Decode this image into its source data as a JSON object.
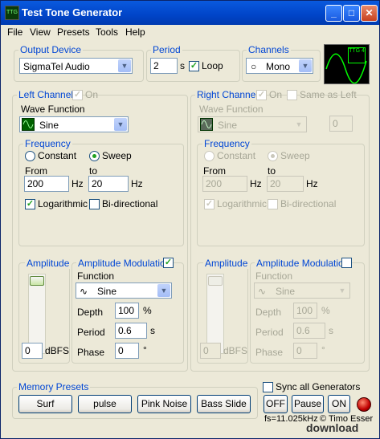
{
  "window": {
    "title": "Test Tone Generator",
    "icon_text": "TTG"
  },
  "menu": [
    {
      "label": "File"
    },
    {
      "label": "View"
    },
    {
      "label": "Presets"
    },
    {
      "label": "Tools"
    },
    {
      "label": "Help"
    }
  ],
  "output_device": {
    "label": "Output Device",
    "value": "SigmaTel Audio"
  },
  "period": {
    "label": "Period",
    "value": "2",
    "unit": "s",
    "loop_label": "Loop",
    "loop_checked": true
  },
  "channels": {
    "label": "Channels",
    "value": "Mono"
  },
  "scope": {
    "tag": "TTG 4"
  },
  "left": {
    "title": "Left Channel",
    "on_label": "On",
    "wave_function_label": "Wave Function",
    "wave": "Sine",
    "frequency_label": "Frequency",
    "constant_label": "Constant",
    "sweep_label": "Sweep",
    "from_label": "From",
    "to_label": "to",
    "from_value": "200",
    "to_value": "20",
    "hz": "Hz",
    "log_label": "Logarithmic",
    "bidir_label": "Bi-directional",
    "amplitude_label": "Amplitude",
    "amplitude_value": "0",
    "dbfs": "dBFS",
    "am_label": "Amplitude Modulation",
    "function_label": "Function",
    "am_function": "Sine",
    "depth_label": "Depth",
    "depth_value": "100",
    "depth_unit": "%",
    "period_label": "Period",
    "period_value": "0.6",
    "period_unit": "s",
    "phase_label": "Phase",
    "phase_value": "0",
    "phase_unit": "°"
  },
  "right": {
    "title": "Right Channel",
    "on_label": "On",
    "same_as_left_label": "Same as Left",
    "wave_function_label": "Wave Function",
    "wave": "Sine",
    "offset_value": "0",
    "frequency_label": "Frequency",
    "constant_label": "Constant",
    "sweep_label": "Sweep",
    "from_label": "From",
    "to_label": "to",
    "from_value": "200",
    "to_value": "20",
    "hz": "Hz",
    "log_label": "Logarithmic",
    "bidir_label": "Bi-directional",
    "amplitude_label": "Amplitude",
    "amplitude_value": "0",
    "dbfs": "dBFS",
    "am_label": "Amplitude Modulation",
    "function_label": "Function",
    "am_function": "Sine",
    "depth_label": "Depth",
    "depth_value": "100",
    "depth_unit": "%",
    "period_label": "Period",
    "period_value": "0.6",
    "period_unit": "s",
    "phase_label": "Phase",
    "phase_value": "0",
    "phase_unit": "°"
  },
  "memory": {
    "label": "Memory Presets",
    "presets": [
      "Surf",
      "pulse",
      "Pink Noise",
      "Bass Slide"
    ]
  },
  "footer": {
    "sync_label": "Sync all Generators",
    "off_label": "OFF",
    "pause_label": "Pause",
    "on_label": "ON",
    "status": "fs=11.025kHz",
    "copyright": "© Timo Esser"
  },
  "watermark": "download"
}
